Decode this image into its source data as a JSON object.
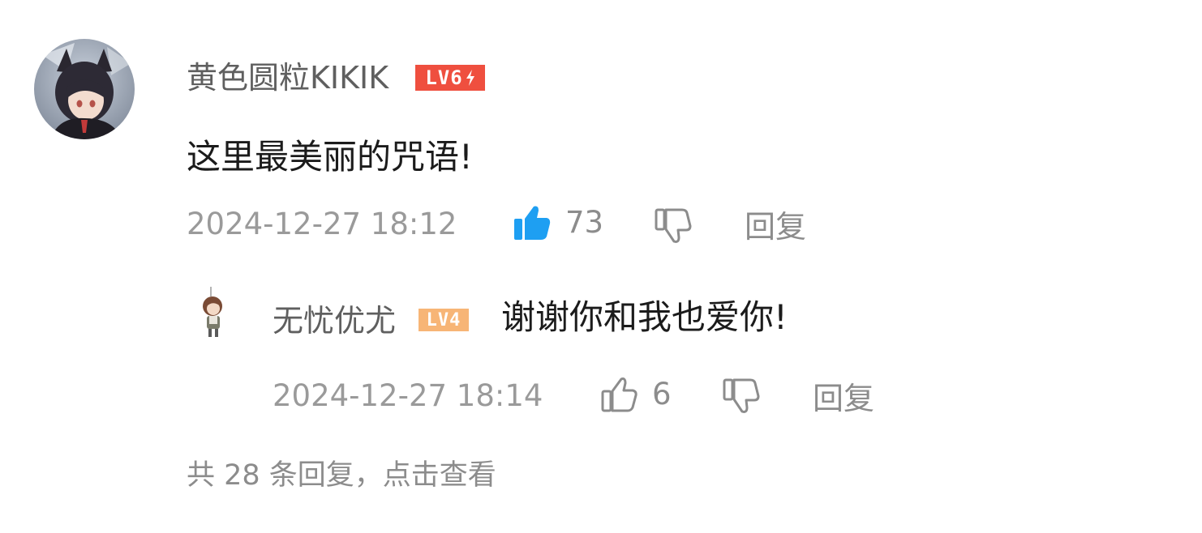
{
  "comment": {
    "username": "黄色圆粒KIKIK",
    "level_badge": "LV6",
    "text": "这里最美丽的咒语!",
    "timestamp": "2024-12-27 18:12",
    "like_count": "73",
    "liked": true,
    "reply_label": "回复"
  },
  "reply": {
    "username": "无忧优尤",
    "level_badge": "LV4",
    "text": "谢谢你和我也爱你!",
    "timestamp": "2024-12-27 18:14",
    "like_count": "6",
    "liked": false,
    "reply_label": "回复"
  },
  "view_replies_text": "共 28 条回复，点击查看",
  "colors": {
    "lv6_badge": "#ef4f3f",
    "lv4_badge": "#f7b576",
    "like_active": "#1e9ff2",
    "meta_gray": "#9a9a9a"
  },
  "icons": {
    "like_active": "thumbs-up-filled-icon",
    "like": "thumbs-up-outline-icon",
    "dislike": "thumbs-down-outline-icon",
    "lightning": "lightning-icon"
  }
}
